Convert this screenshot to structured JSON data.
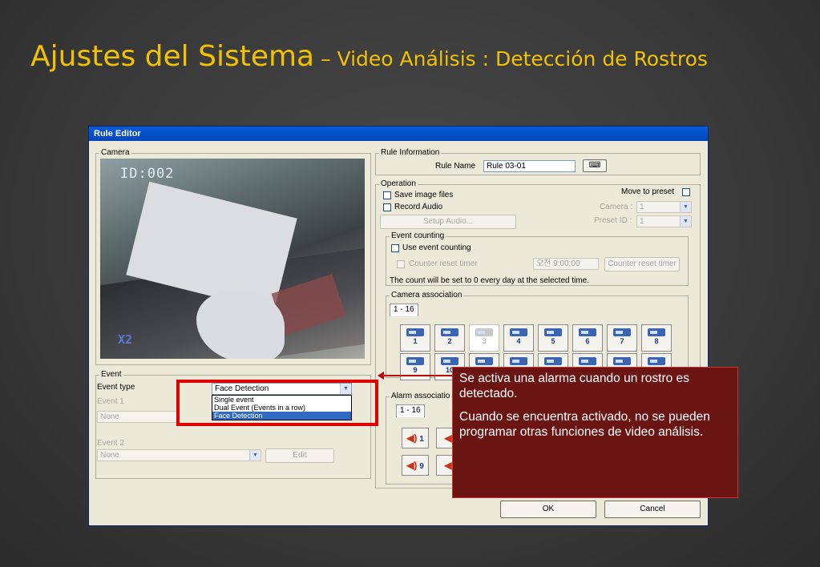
{
  "slide": {
    "title_main": "Ajustes del Sistema",
    "title_sub": " – Video Análisis : Detección de Rostros"
  },
  "dialog": {
    "title": "Rule Editor",
    "camera_group": "Camera",
    "camera_overlay_id": "ID:002",
    "camera_overlay_zoom": "X2",
    "event_group": "Event",
    "event_type_label": "Event type",
    "event_type_value": "Face Detection",
    "event_type_options": [
      "Single event",
      "Dual Event (Events in a row)",
      "Face Detection"
    ],
    "event1_label": "Event 1",
    "event1_value": "None",
    "event2_label": "Event 2",
    "event2_value": "None",
    "edit_label": "Edit",
    "rule_info_group": "Rule Information",
    "rule_name_label": "Rule Name",
    "rule_name_value": "Rule 03-01",
    "operation_group": "Operation",
    "save_image_files": "Save image files",
    "record_audio": "Record Audio",
    "setup_audio": "Setup Audio...",
    "move_to_preset": "Move to preset",
    "camera_label": "Camera :",
    "camera_value": "1",
    "preset_label": "Preset ID :",
    "preset_value": "1",
    "event_counting_group": "Event counting",
    "use_event_counting": "Use event counting",
    "counter_reset_timer": "Counter reset timer",
    "timer_value": "오전  9:00:00",
    "counter_reset_button": "Counter reset timer",
    "count_note": "The count will be set to 0 every day at the selected time.",
    "camera_association_group": "Camera association",
    "camera_tab": "1 - 16",
    "cameras_row1": [
      "1",
      "2",
      "3",
      "4",
      "5",
      "6",
      "7",
      "8"
    ],
    "cameras_row2": [
      "9",
      "10"
    ],
    "alarm_association_group": "Alarm associatio",
    "alarm_tab": "1 - 16",
    "alarms": [
      "1",
      "9"
    ],
    "ok_label": "OK",
    "cancel_label": "Cancel"
  },
  "callout": {
    "p1": "Se activa una alarma cuando un rostro es detectado.",
    "p2": "Cuando se encuentra activado, no se pueden programar otras funciones de video análisis."
  },
  "colors": {
    "title": "#f2c200",
    "callout_bg": "#6b1513",
    "highlight": "#e00000"
  }
}
